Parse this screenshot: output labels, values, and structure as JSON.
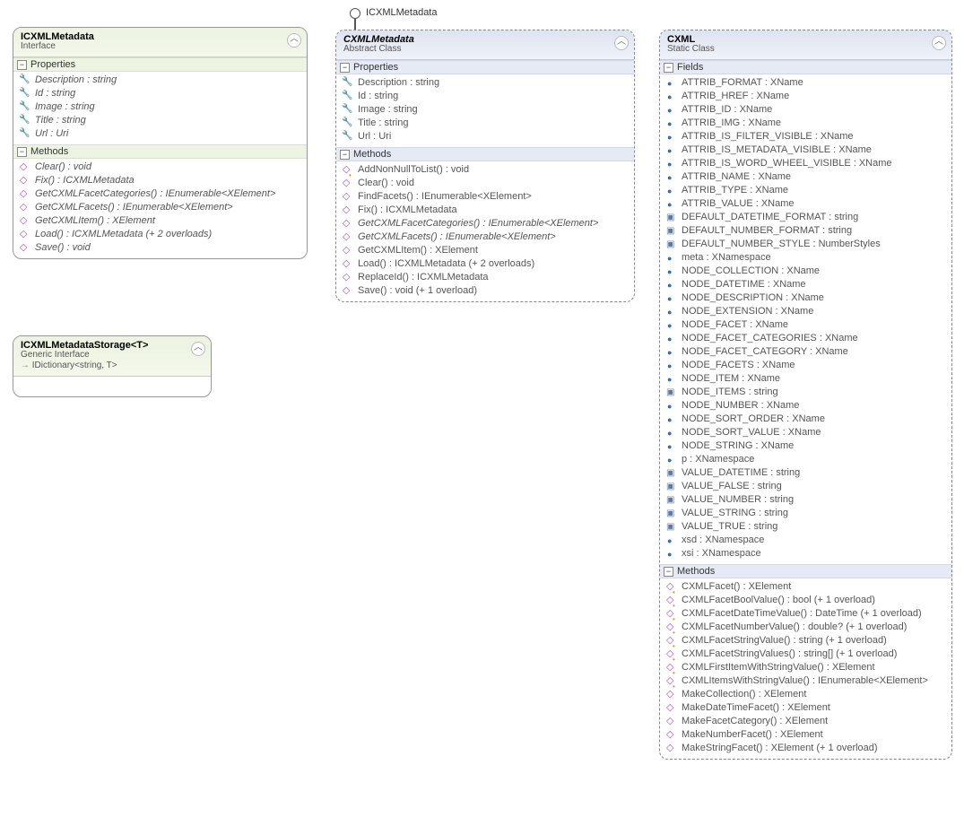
{
  "lollipop": {
    "label": "ICXMLMetadata"
  },
  "labels": {
    "properties": "Properties",
    "methods": "Methods",
    "fields": "Fields"
  },
  "boxes": [
    {
      "title": "ICXMLMetadata",
      "subtitle": "Interface",
      "properties": [
        "Description : string",
        "Id : string",
        "Image : string",
        "Title : string",
        "Url : Uri"
      ],
      "methods": [
        "Clear() : void",
        "Fix() : ICXMLMetadata",
        "GetCXMLFacetCategories() : IEnumerable<XElement>",
        "GetCXMLFacets() : IEnumerable<XElement>",
        "GetCXMLItem() : XElement",
        "Load() : ICXMLMetadata (+ 2 overloads)",
        "Save() : void"
      ]
    },
    {
      "title": "ICXMLMetadataStorage<T>",
      "subtitle": "Generic Interface",
      "inherits": "IDictionary<string, T>"
    },
    {
      "title": "CXMLMetadata",
      "subtitle": "Abstract Class",
      "properties": [
        "Description : string",
        "Id : string",
        "Image : string",
        "Title : string",
        "Url : Uri"
      ],
      "methods": [
        "AddNonNullToList() : void",
        "Clear() : void",
        "FindFacets() : IEnumerable<XElement>",
        "Fix() : ICXMLMetadata",
        "GetCXMLFacetCategories() : IEnumerable<XElement>",
        "GetCXMLFacets() : IEnumerable<XElement>",
        "GetCXMLItem() : XElement",
        "Load() : ICXMLMetadata (+ 2 overloads)",
        "ReplaceId() : ICXMLMetadata",
        "Save() : void (+ 1 overload)"
      ]
    },
    {
      "title": "CXML",
      "subtitle": "Static Class",
      "fields": [
        {
          "t": "ATTRIB_FORMAT : XName",
          "k": "f"
        },
        {
          "t": "ATTRIB_HREF : XName",
          "k": "f"
        },
        {
          "t": "ATTRIB_ID : XName",
          "k": "f"
        },
        {
          "t": "ATTRIB_IMG : XName",
          "k": "f"
        },
        {
          "t": "ATTRIB_IS_FILTER_VISIBLE : XName",
          "k": "f"
        },
        {
          "t": "ATTRIB_IS_METADATA_VISIBLE : XName",
          "k": "f"
        },
        {
          "t": "ATTRIB_IS_WORD_WHEEL_VISIBLE : XName",
          "k": "f"
        },
        {
          "t": "ATTRIB_NAME : XName",
          "k": "f"
        },
        {
          "t": "ATTRIB_TYPE : XName",
          "k": "f"
        },
        {
          "t": "ATTRIB_VALUE : XName",
          "k": "f"
        },
        {
          "t": "DEFAULT_DATETIME_FORMAT : string",
          "k": "c"
        },
        {
          "t": "DEFAULT_NUMBER_FORMAT : string",
          "k": "c"
        },
        {
          "t": "DEFAULT_NUMBER_STYLE : NumberStyles",
          "k": "c"
        },
        {
          "t": "meta : XNamespace",
          "k": "f"
        },
        {
          "t": "NODE_COLLECTION : XName",
          "k": "f"
        },
        {
          "t": "NODE_DATETIME : XName",
          "k": "f"
        },
        {
          "t": "NODE_DESCRIPTION : XName",
          "k": "f"
        },
        {
          "t": "NODE_EXTENSION : XName",
          "k": "f"
        },
        {
          "t": "NODE_FACET : XName",
          "k": "f"
        },
        {
          "t": "NODE_FACET_CATEGORIES : XName",
          "k": "f"
        },
        {
          "t": "NODE_FACET_CATEGORY : XName",
          "k": "f"
        },
        {
          "t": "NODE_FACETS : XName",
          "k": "f"
        },
        {
          "t": "NODE_ITEM : XName",
          "k": "f"
        },
        {
          "t": "NODE_ITEMS : string",
          "k": "c"
        },
        {
          "t": "NODE_NUMBER : XName",
          "k": "f"
        },
        {
          "t": "NODE_SORT_ORDER : XName",
          "k": "f"
        },
        {
          "t": "NODE_SORT_VALUE : XName",
          "k": "f"
        },
        {
          "t": "NODE_STRING : XName",
          "k": "f"
        },
        {
          "t": "p : XNamespace",
          "k": "f"
        },
        {
          "t": "VALUE_DATETIME : string",
          "k": "c"
        },
        {
          "t": "VALUE_FALSE : string",
          "k": "c"
        },
        {
          "t": "VALUE_NUMBER : string",
          "k": "c"
        },
        {
          "t": "VALUE_STRING : string",
          "k": "c"
        },
        {
          "t": "VALUE_TRUE : string",
          "k": "c"
        },
        {
          "t": "xsd : XNamespace",
          "k": "f"
        },
        {
          "t": "xsi : XNamespace",
          "k": "f"
        }
      ],
      "methods": [
        {
          "t": "CXMLFacet() : XElement",
          "k": "e"
        },
        {
          "t": "CXMLFacetBoolValue() : bool (+ 1 overload)",
          "k": "e"
        },
        {
          "t": "CXMLFacetDateTimeValue() : DateTime (+ 1 overload)",
          "k": "e"
        },
        {
          "t": "CXMLFacetNumberValue() : double? (+ 1 overload)",
          "k": "e"
        },
        {
          "t": "CXMLFacetStringValue() : string (+ 1 overload)",
          "k": "e"
        },
        {
          "t": "CXMLFacetStringValues() : string[] (+ 1 overload)",
          "k": "e"
        },
        {
          "t": "CXMLFirstItemWithStringValue() : XElement",
          "k": "e"
        },
        {
          "t": "CXMLItemsWithStringValue() : IEnumerable<XElement>",
          "k": "e"
        },
        {
          "t": "MakeCollection() : XElement",
          "k": "m"
        },
        {
          "t": "MakeDateTimeFacet() : XElement",
          "k": "m"
        },
        {
          "t": "MakeFacetCategory() : XElement",
          "k": "m"
        },
        {
          "t": "MakeNumberFacet() : XElement",
          "k": "m"
        },
        {
          "t": "MakeStringFacet() : XElement (+ 1 overload)",
          "k": "m"
        }
      ]
    }
  ]
}
